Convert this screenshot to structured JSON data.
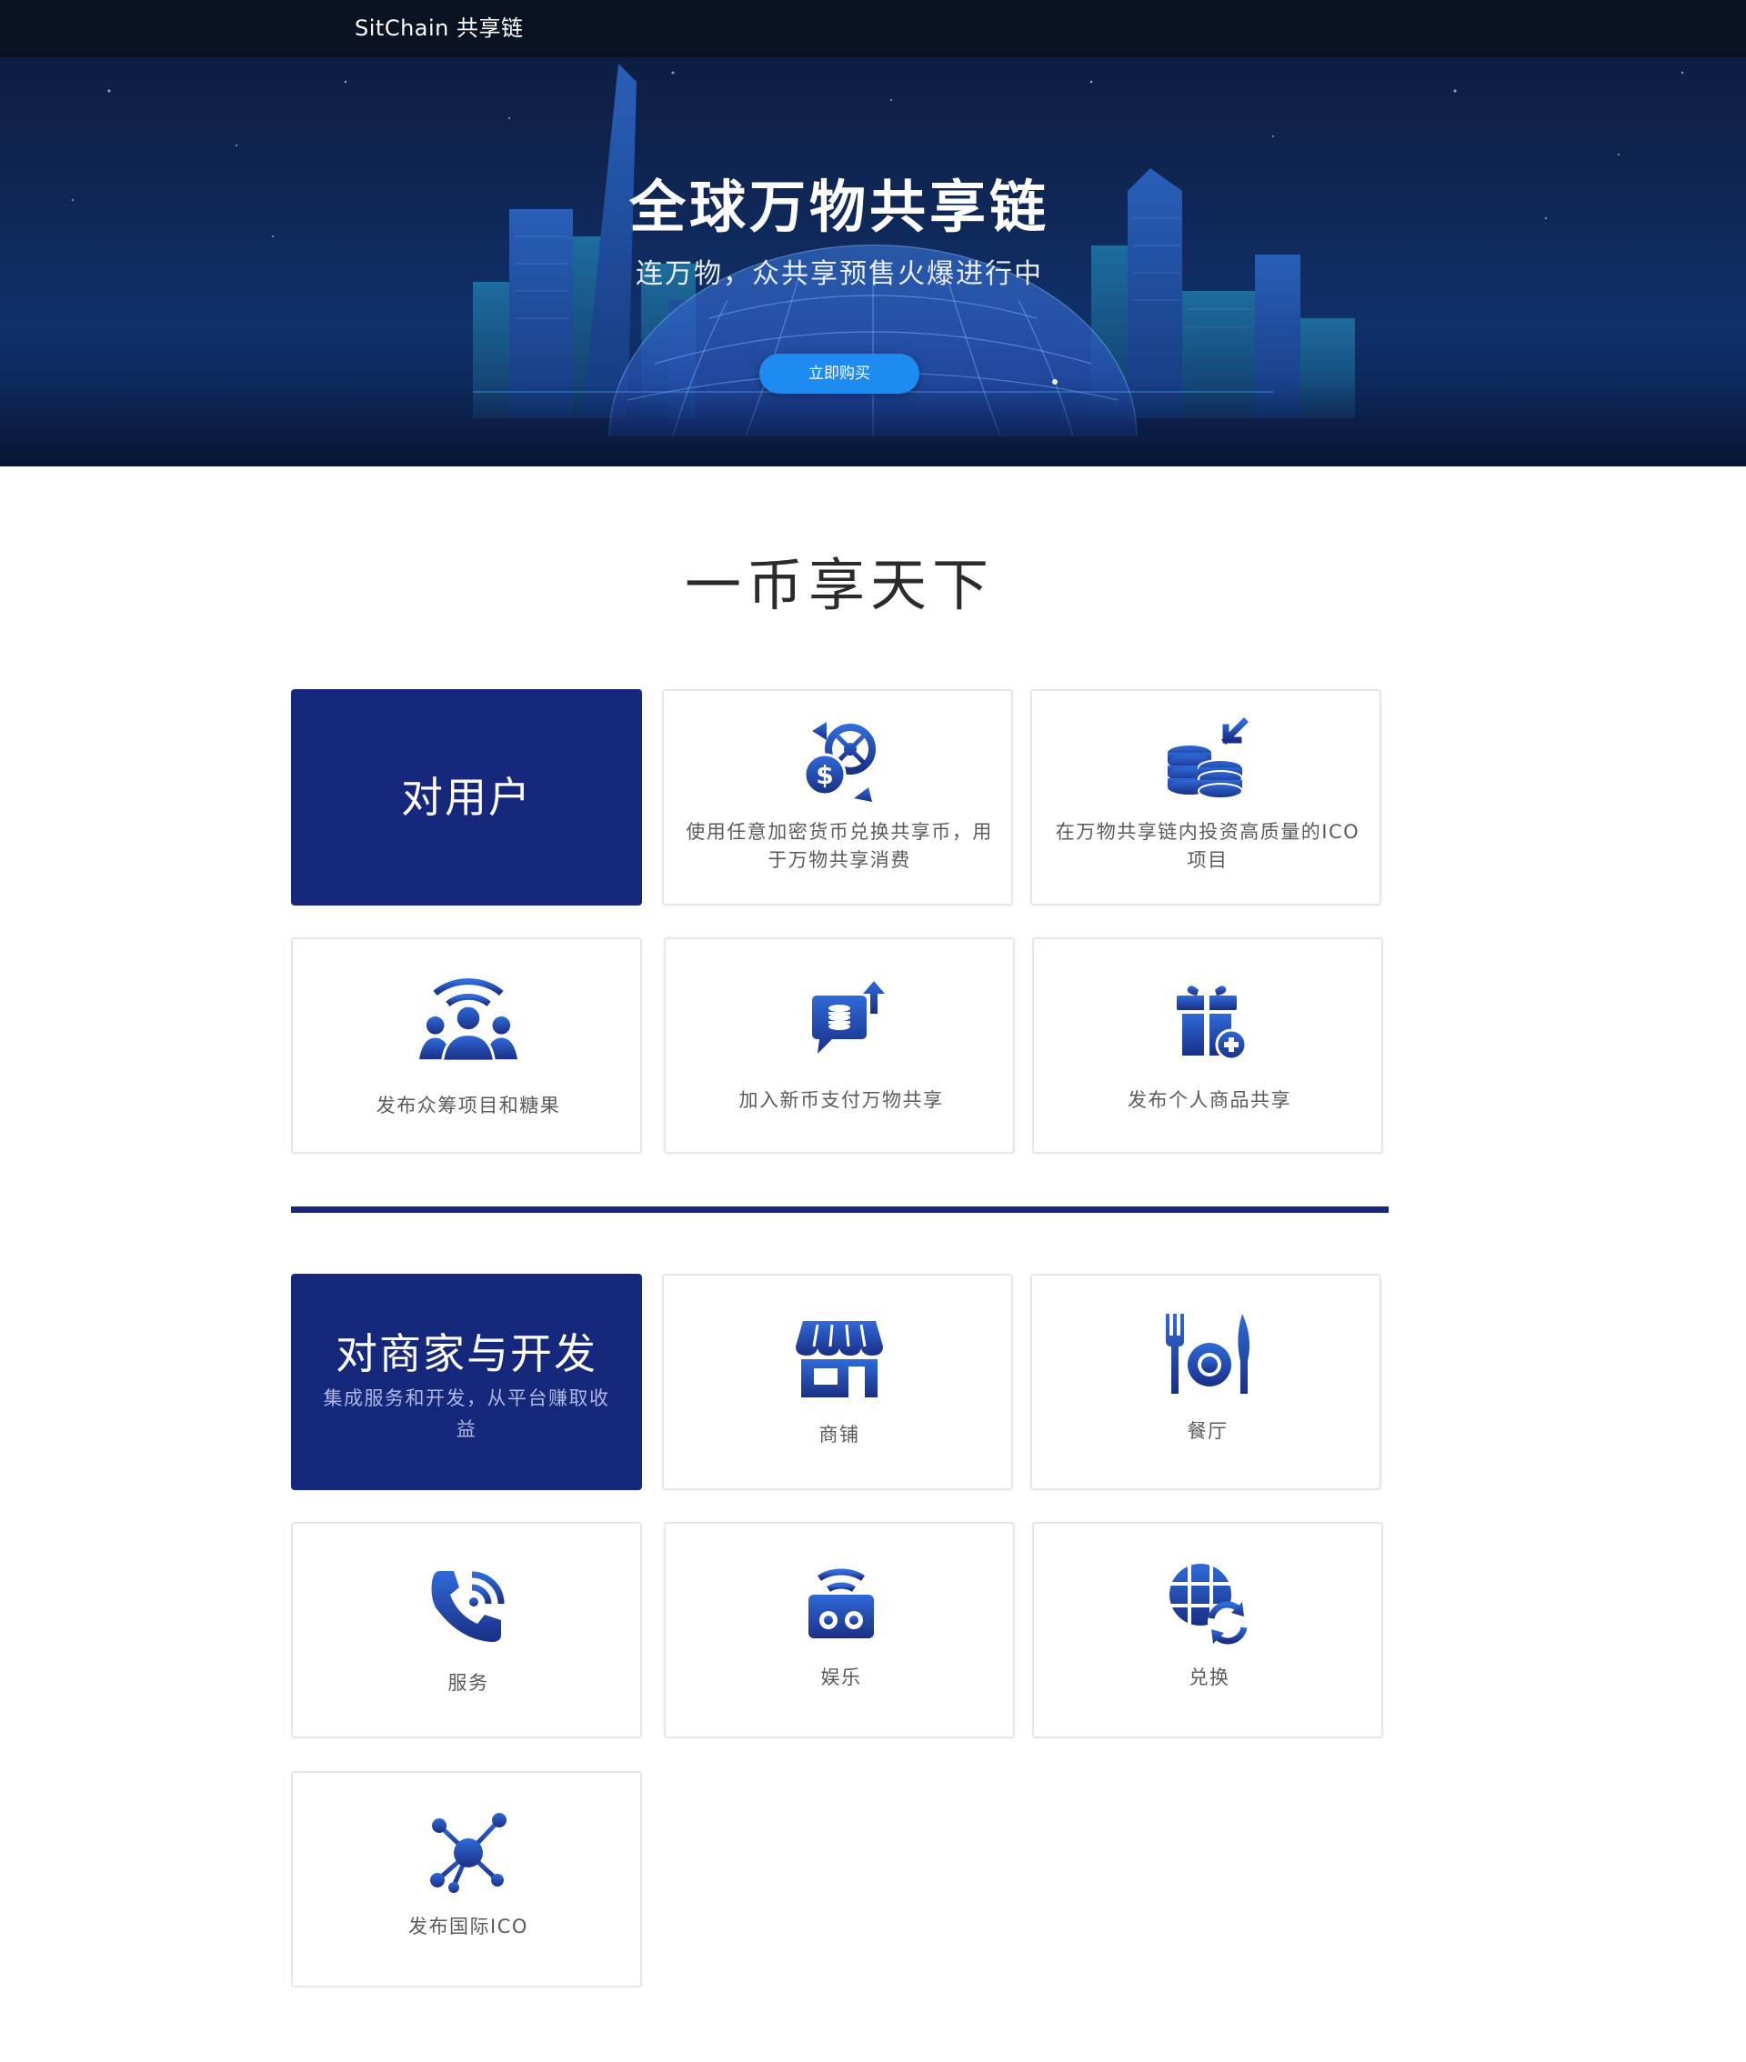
{
  "header": {
    "brand": "SitChain 共享链"
  },
  "hero": {
    "title": "全球万物共享链",
    "subtitle": "连万物，众共享预售火爆进行中",
    "buy_button": "立即购买"
  },
  "section_title": "一币享天下",
  "users": {
    "heading": "对用户",
    "items": [
      {
        "label": "使用任意加密货币兑换共享币，用于万物共享消费",
        "icon": "currency-exchange-icon"
      },
      {
        "label": "在万物共享链内投资高质量的ICO项目",
        "icon": "coin-stack-icon"
      },
      {
        "label": "发布众筹项目和糖果",
        "icon": "crowdfunding-people-icon"
      },
      {
        "label": "加入新币支付万物共享",
        "icon": "coin-upload-chat-icon"
      },
      {
        "label": "发布个人商品共享",
        "icon": "gift-add-icon"
      }
    ]
  },
  "merchants": {
    "heading": "对商家与开发",
    "subtitle": "集成服务和开发，从平台赚取收益",
    "items": [
      {
        "label": "商铺",
        "icon": "shop-icon"
      },
      {
        "label": "餐厅",
        "icon": "restaurant-icon"
      },
      {
        "label": "服务",
        "icon": "phone-service-icon"
      },
      {
        "label": "娱乐",
        "icon": "entertainment-radio-icon"
      },
      {
        "label": "兑换",
        "icon": "globe-exchange-icon"
      },
      {
        "label": "发布国际ICO",
        "icon": "network-icon"
      }
    ]
  },
  "colors": {
    "brand_blue": "#16287c",
    "button_blue": "#1e8bf2",
    "icon_blue_light": "#2f6ad8",
    "icon_blue_dark": "#1a2f86"
  }
}
